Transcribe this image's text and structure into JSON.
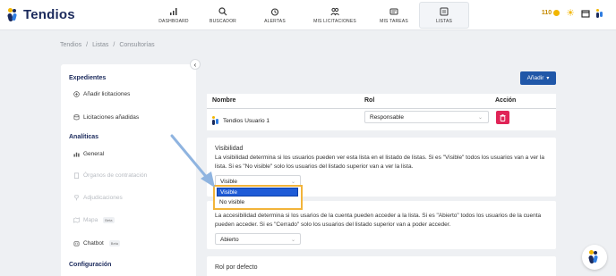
{
  "app": {
    "name": "Tendios"
  },
  "nav": [
    {
      "label": "DASHBOARD",
      "icon": "bar-chart-icon"
    },
    {
      "label": "BUSCADOR",
      "icon": "search-icon"
    },
    {
      "label": "ALERTAS",
      "icon": "alarm-clock-icon"
    },
    {
      "label": "MIS LICITACIONES",
      "icon": "people-icon"
    },
    {
      "label": "MIS TAREAS",
      "icon": "card-icon"
    },
    {
      "label": "LISTAS",
      "icon": "list-icon",
      "active": true
    }
  ],
  "topright": {
    "coins": "110",
    "icons": [
      "coin-icon",
      "sun-icon",
      "calendar-icon",
      "avatar-logo"
    ]
  },
  "breadcrumb": [
    "Tendios",
    "/",
    "Listas",
    "/",
    "Consultorías"
  ],
  "sidebar": {
    "sections": [
      {
        "title": "Expedientes",
        "items": [
          {
            "label": "Añadir licitaciones",
            "icon": "plus-circle-icon",
            "disabled": false
          },
          {
            "label": "Licitaciones añadidas",
            "icon": "database-icon",
            "disabled": false
          }
        ]
      },
      {
        "title": "Analíticas",
        "items": [
          {
            "label": "General",
            "icon": "chart-icon",
            "disabled": false
          },
          {
            "label": "Órganos de contratación",
            "icon": "building-icon",
            "disabled": true
          },
          {
            "label": "Adjudicaciones",
            "icon": "trophy-icon",
            "disabled": true
          },
          {
            "label": "Mapa",
            "icon": "map-icon",
            "disabled": true,
            "badge": "Beta"
          },
          {
            "label": "Chatbot",
            "icon": "robot-icon",
            "disabled": false,
            "badge": "Beta"
          }
        ]
      },
      {
        "title": "Configuración",
        "items": []
      }
    ]
  },
  "main": {
    "add_button": "Añadir",
    "table": {
      "headers": [
        "Nombre",
        "Rol",
        "Acción"
      ],
      "rows": [
        {
          "name": "Tendios Usuario 1",
          "role": "Responsable"
        }
      ]
    },
    "visibility": {
      "title": "Visibilidad",
      "description": "La visibilidad determina si los usuarios pueden ver esta lista en el listado de listas. Si es \"Visible\" todos los usuarios van a ver la lista. Si es \"No visible\" solo los usuarios del listado superior van a ver la lista.",
      "value": "Visible",
      "options": [
        "Visible",
        "No visible"
      ],
      "selected_index": 0
    },
    "accessibility": {
      "description": "La accesibilidad determina si los usarios de la cuenta pueden acceder a la lista. Si es \"Abierto\" todos los usuarios de la cuenta pueden acceder. Si es \"Cerrado\" solo los usuarios del listado superior van a poder acceder.",
      "value": "Abierto"
    },
    "default_role": {
      "title": "Rol por defecto"
    }
  },
  "colors": {
    "brand": "#1b2a5c",
    "accent": "#2057a8",
    "danger": "#e02457",
    "highlight": "#f2b43a"
  }
}
